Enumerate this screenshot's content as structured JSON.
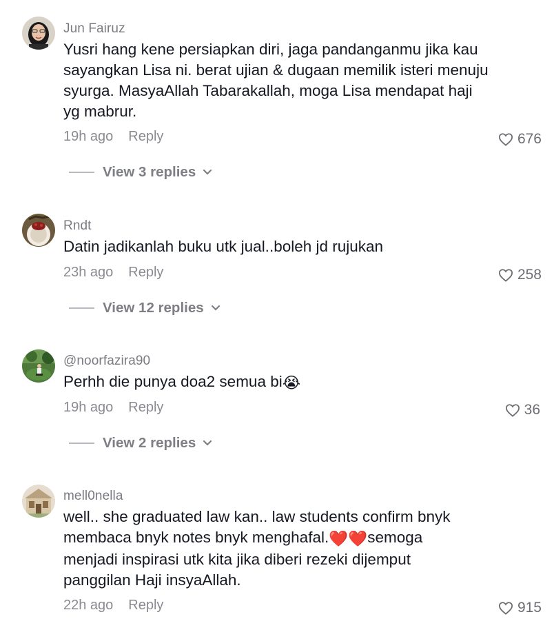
{
  "comments": [
    {
      "username": "Jun Fairuz",
      "text": "Yusri hang kene persiapkan diri, jaga pandanganmu jika kau sayangkan Lisa ni. berat ujian & dugaan memilik isteri menuju syurga. MasyaAllah Tabarakallah, moga Lisa mendapat haji yg mabrur.",
      "time": "19h ago",
      "reply": "Reply",
      "likes": "676",
      "view_replies": "View 3 replies"
    },
    {
      "username": "Rndt",
      "text": "Datin jadikanlah buku utk jual..boleh jd rujukan",
      "time": "23h ago",
      "reply": "Reply",
      "likes": "258",
      "view_replies": "View 12 replies"
    },
    {
      "username": "@noorfazira90",
      "text": "Perhh die punya doa2 semua bi",
      "text_emoji": "😭",
      "time": "19h ago",
      "reply": "Reply",
      "likes": "36",
      "view_replies": "View 2 replies"
    },
    {
      "username": "mell0nella",
      "text_part1": "well.. she graduated law kan.. law students confirm bnyk membaca bnyk notes bnyk menghafal.",
      "text_emoji": "❤️❤️",
      "text_part2": "semoga menjadi inspirasi utk kita jika diberi rezeki dijemput panggilan Haji insyaAllah.",
      "time": "22h ago",
      "reply": "Reply",
      "likes": "915"
    }
  ],
  "icons": {
    "like": "heart-outline-icon",
    "expand": "chevron-down-icon"
  },
  "colors": {
    "text": "#161823",
    "muted": "#8a8b91",
    "divider": "#b9bac0"
  }
}
